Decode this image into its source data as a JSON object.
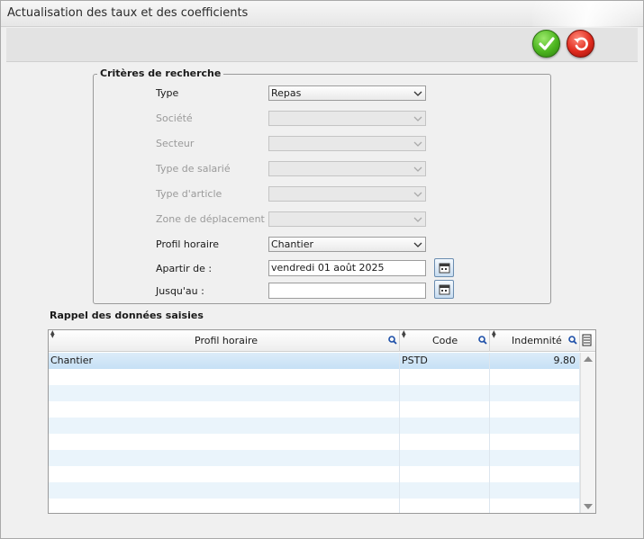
{
  "window": {
    "title": "Actualisation des taux et des coefficients"
  },
  "criteria": {
    "legend": "Critères de recherche",
    "type": {
      "label": "Type",
      "value": "Repas"
    },
    "societe": {
      "label": "Société",
      "value": ""
    },
    "secteur": {
      "label": "Secteur",
      "value": ""
    },
    "type_salarie": {
      "label": "Type de salarié",
      "value": ""
    },
    "type_article": {
      "label": "Type d'article",
      "value": ""
    },
    "zone_deplacement": {
      "label": "Zone de déplacement",
      "value": ""
    },
    "profil_horaire": {
      "label": "Profil horaire",
      "value": "Chantier"
    },
    "apartir": {
      "label": "Apartir de :",
      "value": "vendredi 01 août 2025"
    },
    "jusquau": {
      "label": "Jusqu'au :",
      "value": ""
    }
  },
  "recap": {
    "title": "Rappel des données saisies",
    "columns": [
      "Profil horaire",
      "Code",
      "Indemnité"
    ],
    "rows": [
      {
        "profil": "Chantier",
        "code": "PSTD",
        "indemnite": "9.80"
      }
    ]
  },
  "colors": {
    "accent_selection": "#c6e0f5",
    "ok_green": "#4cb51f",
    "cancel_red": "#e02a1d"
  },
  "icons": [
    "validate-check-icon",
    "cancel-undo-icon",
    "chevron-down-icon",
    "calendar-icon",
    "search-magnifier-icon",
    "columns-config-icon"
  ]
}
